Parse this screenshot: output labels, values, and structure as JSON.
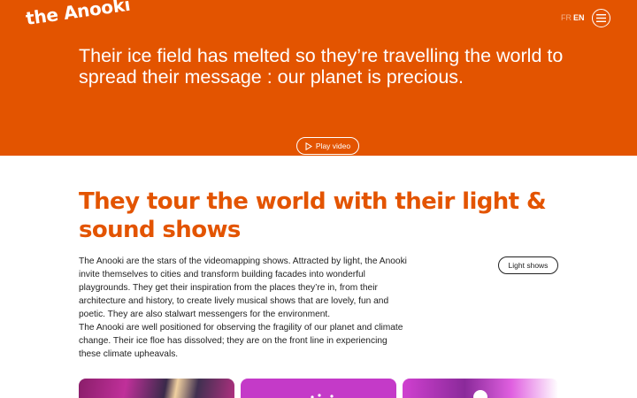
{
  "header": {
    "logo": "the Anooki",
    "lang_fr": "FR",
    "lang_en": "EN",
    "menu_icon": "hamburger-menu-icon"
  },
  "hero": {
    "tagline": "Their ice field has melted so they’re travelling the world to spread their message : our planet is precious.",
    "play_label": "Play video",
    "play_icon": "play-icon",
    "background_color": "#e35400"
  },
  "section": {
    "title": "They tour the world with their light & sound shows",
    "paragraph_1": "The Anooki are the stars of the videomapping shows. Attracted by light, the Anooki invite themselves to cities and transform building facades into wonderful playgrounds. They get their inspiration from the places they’re in, from their architecture and history, to create lively musical shows that are lovely, fun and poetic. They are also stalwart messengers for the environment.",
    "paragraph_2": "The Anooki are well positioned for observing the fragility of our planet and climate change. Their ice floe has dissolved; they are on the front line in experiencing these climate upheavals.",
    "button_label": "Light shows",
    "title_color": "#e35400"
  }
}
